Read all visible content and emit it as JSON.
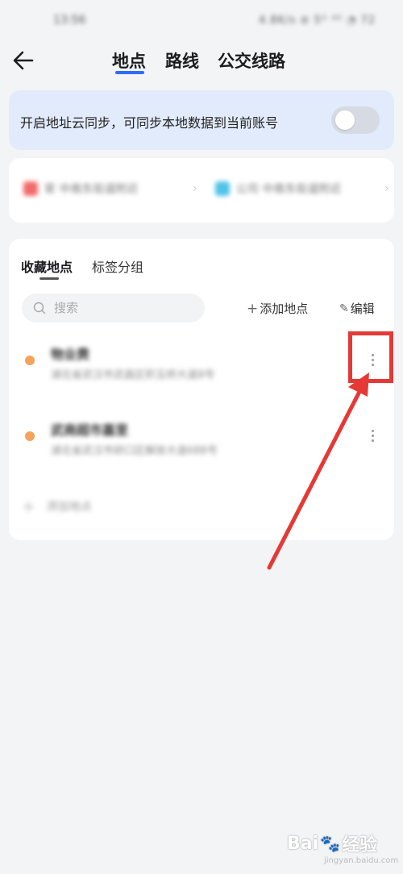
{
  "status_bar": {
    "time": "13:56",
    "indicators": "4.8K/s ⊘ 5ᴳ ⁴ᴳ ◔ 72"
  },
  "nav": {
    "back_icon": "arrow-left-icon",
    "tabs": [
      {
        "label": "地点",
        "active": true
      },
      {
        "label": "路线",
        "active": false
      },
      {
        "label": "公交线路",
        "active": false
      }
    ],
    "accent_color": "#2f6bff"
  },
  "sync_banner": {
    "text": "开启地址云同步，可同步本地数据到当前账号",
    "toggle_on": false
  },
  "shortcuts": {
    "home": {
      "label": "家 中南东街道附近",
      "icon": "home-icon",
      "color": "#f26a6a"
    },
    "company": {
      "label": "公司 中南东街道附近",
      "icon": "briefcase-icon",
      "color": "#4fc3e8"
    }
  },
  "favorites": {
    "sub_tabs": [
      {
        "label": "收藏地点",
        "active": true
      },
      {
        "label": "标签分组",
        "active": false
      }
    ],
    "search_placeholder": "搜索",
    "add_place_label": "添加地点",
    "edit_label": "编辑",
    "places": [
      {
        "name": "物业费",
        "address": "湖北省武汉市武昌区积玉桥大道8号",
        "dot_color": "#f5a35c"
      },
      {
        "name": "武商超市嘉里",
        "address": "湖北省武汉市硚口区解放大道688号",
        "dot_color": "#f5a35c"
      }
    ],
    "add_row_label": "添加地点"
  },
  "watermark": {
    "brand_left": "Bai",
    "brand_right": "经验",
    "sub": "jingyan.baidu.com"
  }
}
